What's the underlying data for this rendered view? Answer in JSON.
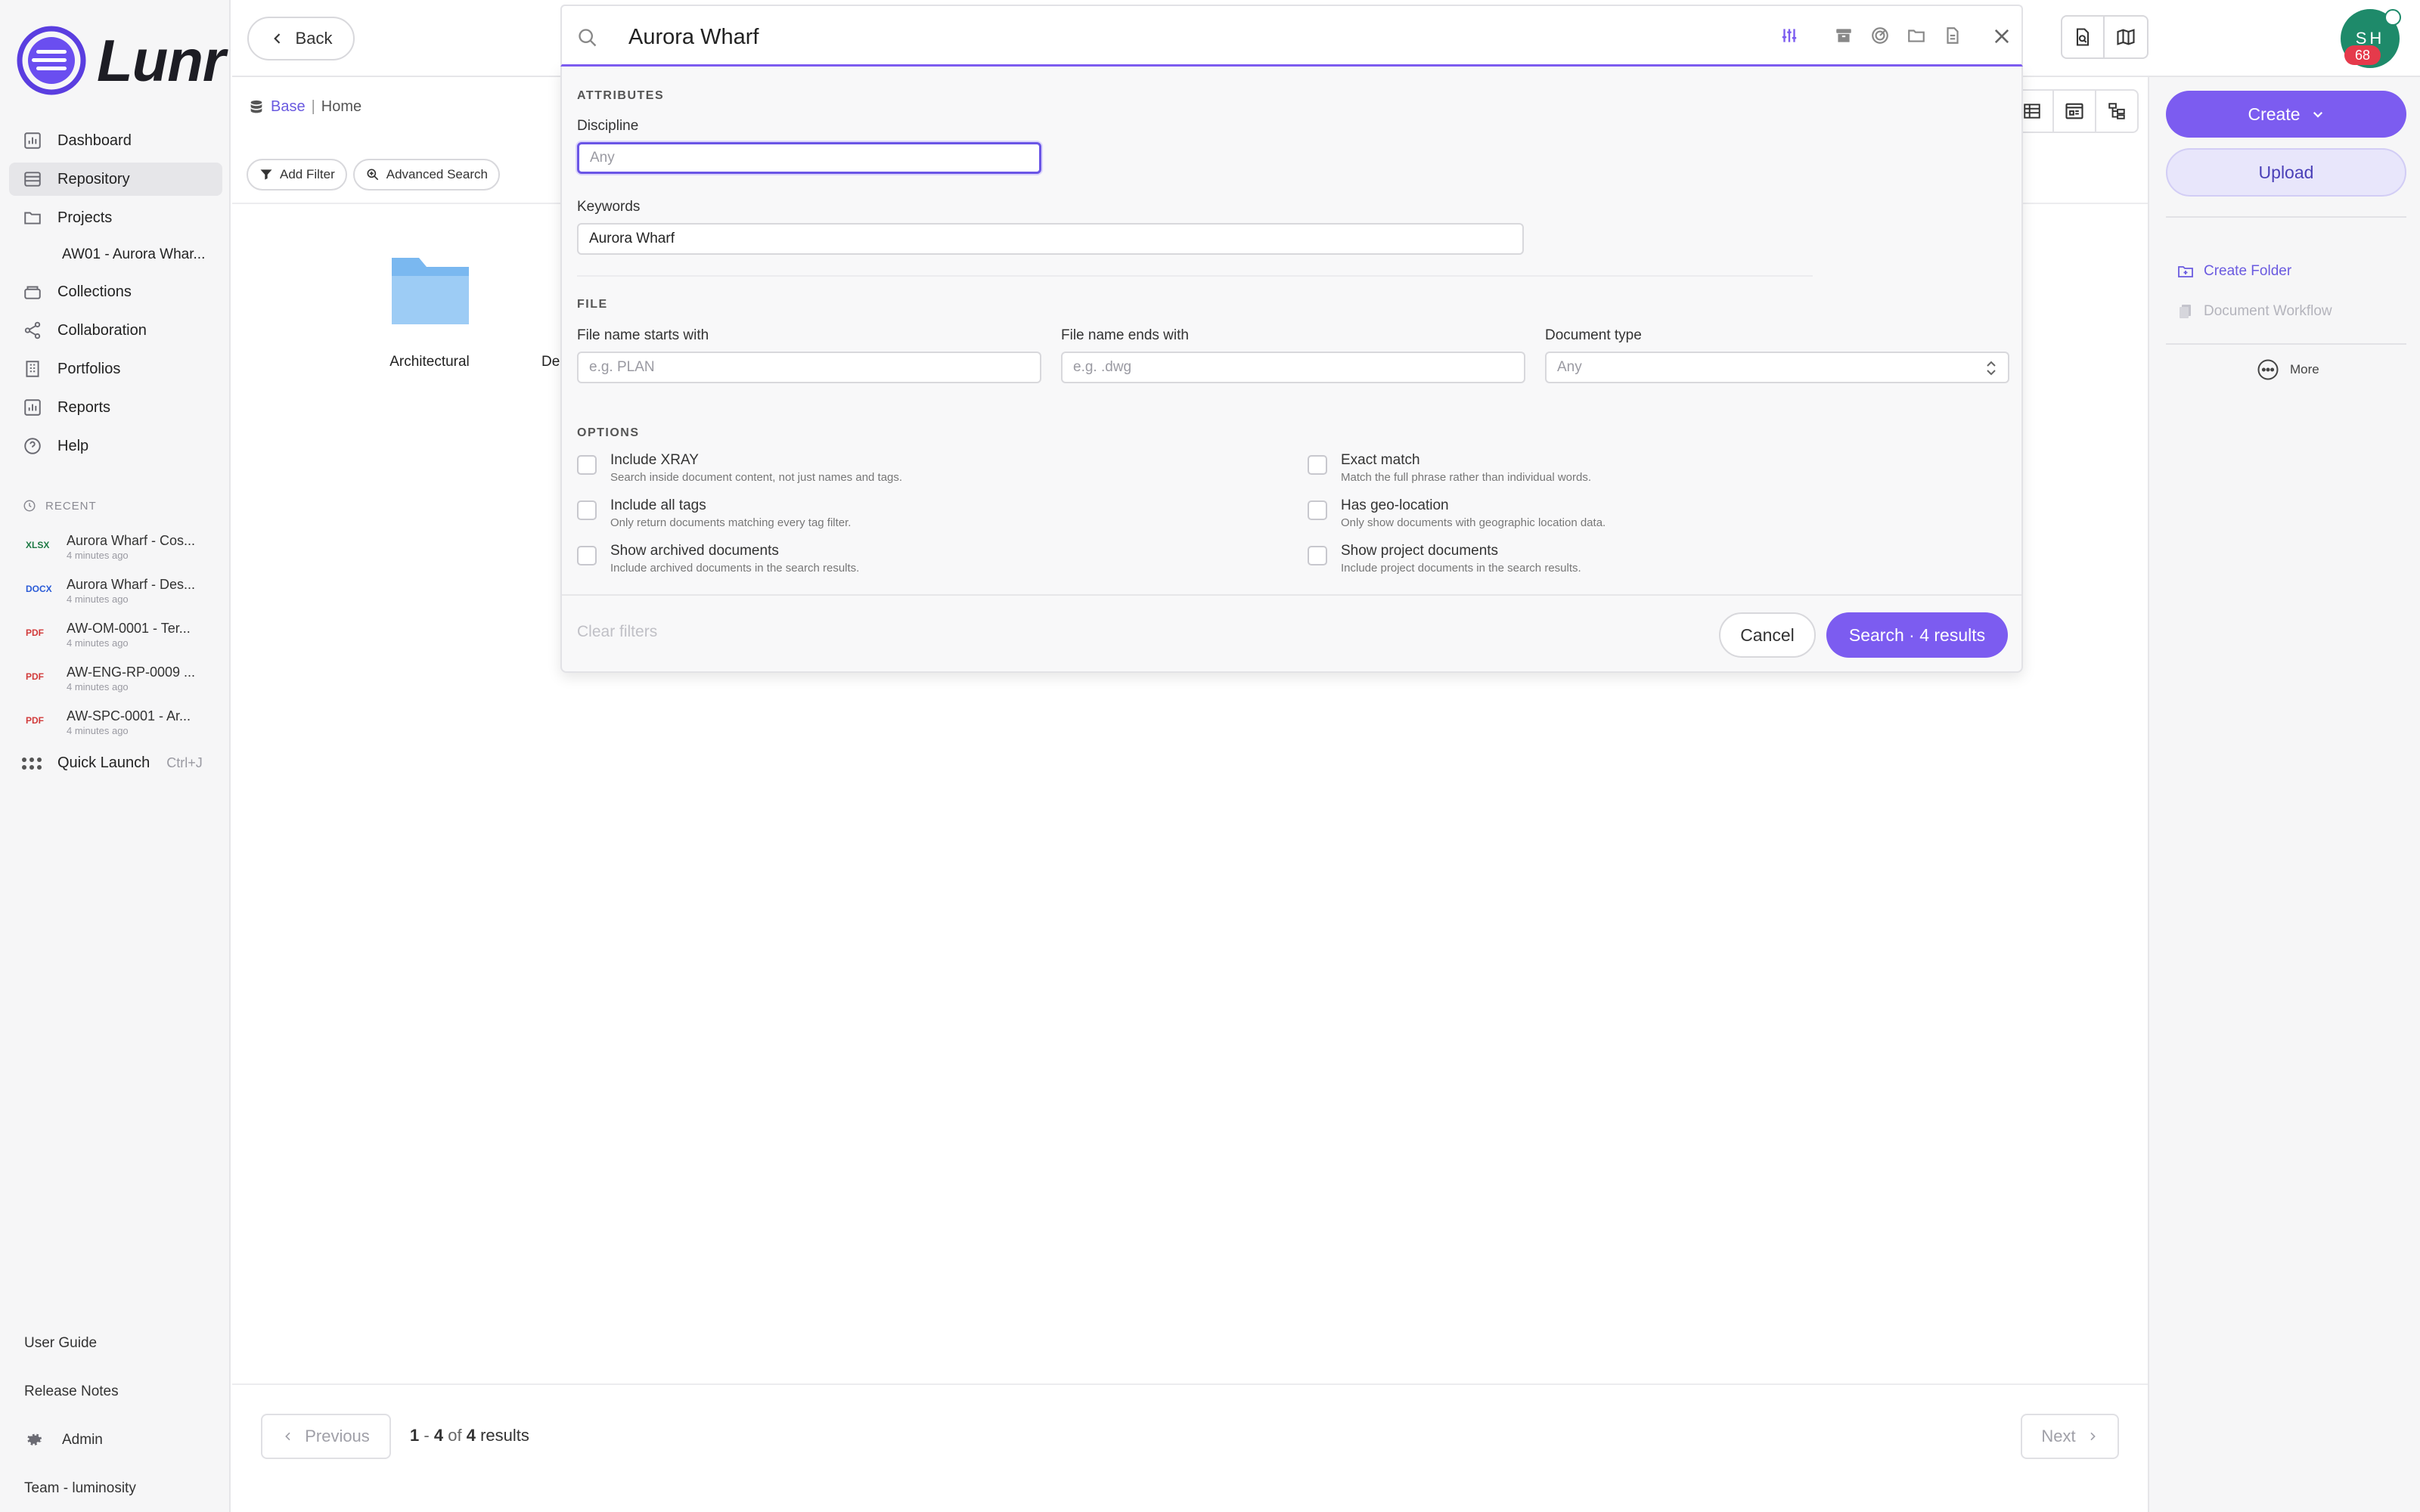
{
  "app": {
    "logo_text": "Lunr"
  },
  "sidebar": {
    "nav": [
      {
        "label": "Dashboard",
        "icon": "chart-icon"
      },
      {
        "label": "Repository",
        "icon": "repository-icon",
        "active": true
      },
      {
        "label": "Projects",
        "icon": "folder-icon"
      }
    ],
    "project_sub": "AW01 - Aurora Whar...",
    "nav2": [
      {
        "label": "Collections",
        "icon": "collections-icon"
      },
      {
        "label": "Collaboration",
        "icon": "share-icon"
      },
      {
        "label": "Portfolios",
        "icon": "building-icon"
      },
      {
        "label": "Reports",
        "icon": "chart-icon"
      },
      {
        "label": "Help",
        "icon": "help-icon"
      }
    ],
    "recent_heading": "RECENT",
    "recent": [
      {
        "type": "XLSX",
        "name": "Aurora Wharf - Cos...",
        "time": "4 minutes ago"
      },
      {
        "type": "DOCX",
        "name": "Aurora Wharf - Des...",
        "time": "4 minutes ago"
      },
      {
        "type": "PDF",
        "name": "AW-OM-0001 - Ter...",
        "time": "4 minutes ago"
      },
      {
        "type": "PDF",
        "name": "AW-ENG-RP-0009 ...",
        "time": "4 minutes ago"
      },
      {
        "type": "PDF",
        "name": "AW-SPC-0001 - Ar...",
        "time": "4 minutes ago"
      }
    ],
    "quick_launch": "Quick Launch",
    "quick_launch_shortcut": "Ctrl+J",
    "user_guide": "User Guide",
    "release_notes": "Release Notes",
    "admin": "Admin",
    "team": "Team - luminosity"
  },
  "topbar": {
    "back_label": "Back",
    "avatar_initials": "SH",
    "avatar_badge": "68"
  },
  "content": {
    "breadcrumb_base": "Base",
    "breadcrumb_sep": "|",
    "breadcrumb_home": "Home",
    "add_filter": "Add Filter",
    "advanced_search": "Advanced Search",
    "folder_label": "Architectural",
    "folder_label2": "De"
  },
  "pagination": {
    "previous": "Previous",
    "range_start": "1",
    "range_dash": "-",
    "range_end": "4",
    "of": "of",
    "total": "4",
    "results": "results",
    "next": "Next"
  },
  "right_panel": {
    "create": "Create",
    "upload": "Upload",
    "create_folder": "Create Folder",
    "document_workflow": "Document Workflow",
    "more": "More"
  },
  "search": {
    "query": "Aurora Wharf",
    "attributes_heading": "ATTRIBUTES",
    "discipline_label": "Discipline",
    "discipline_placeholder": "Any",
    "keywords_label": "Keywords",
    "keywords_value": "Aurora Wharf",
    "file_heading": "FILE",
    "starts_label": "File name starts with",
    "starts_placeholder": "e.g. PLAN",
    "ends_label": "File name ends with",
    "ends_placeholder": "e.g. .dwg",
    "doctype_label": "Document type",
    "doctype_value": "Any",
    "options_heading": "OPTIONS",
    "options": [
      {
        "title": "Include XRAY",
        "desc": "Search inside document content, not just names and tags."
      },
      {
        "title": "Exact match",
        "desc": "Match the full phrase rather than individual words."
      },
      {
        "title": "Include all tags",
        "desc": "Only return documents matching every tag filter."
      },
      {
        "title": "Has geo-location",
        "desc": "Only show documents with geographic location data."
      },
      {
        "title": "Show archived documents",
        "desc": "Include archived documents in the search results."
      },
      {
        "title": "Show project documents",
        "desc": "Include project documents in the search results."
      }
    ],
    "clear_filters": "Clear filters",
    "cancel": "Cancel",
    "search_button": "Search · 4 results"
  },
  "colors": {
    "accent": "#7c5cf0",
    "avatar": "#1e8a6a",
    "badge": "#e53a4b"
  }
}
